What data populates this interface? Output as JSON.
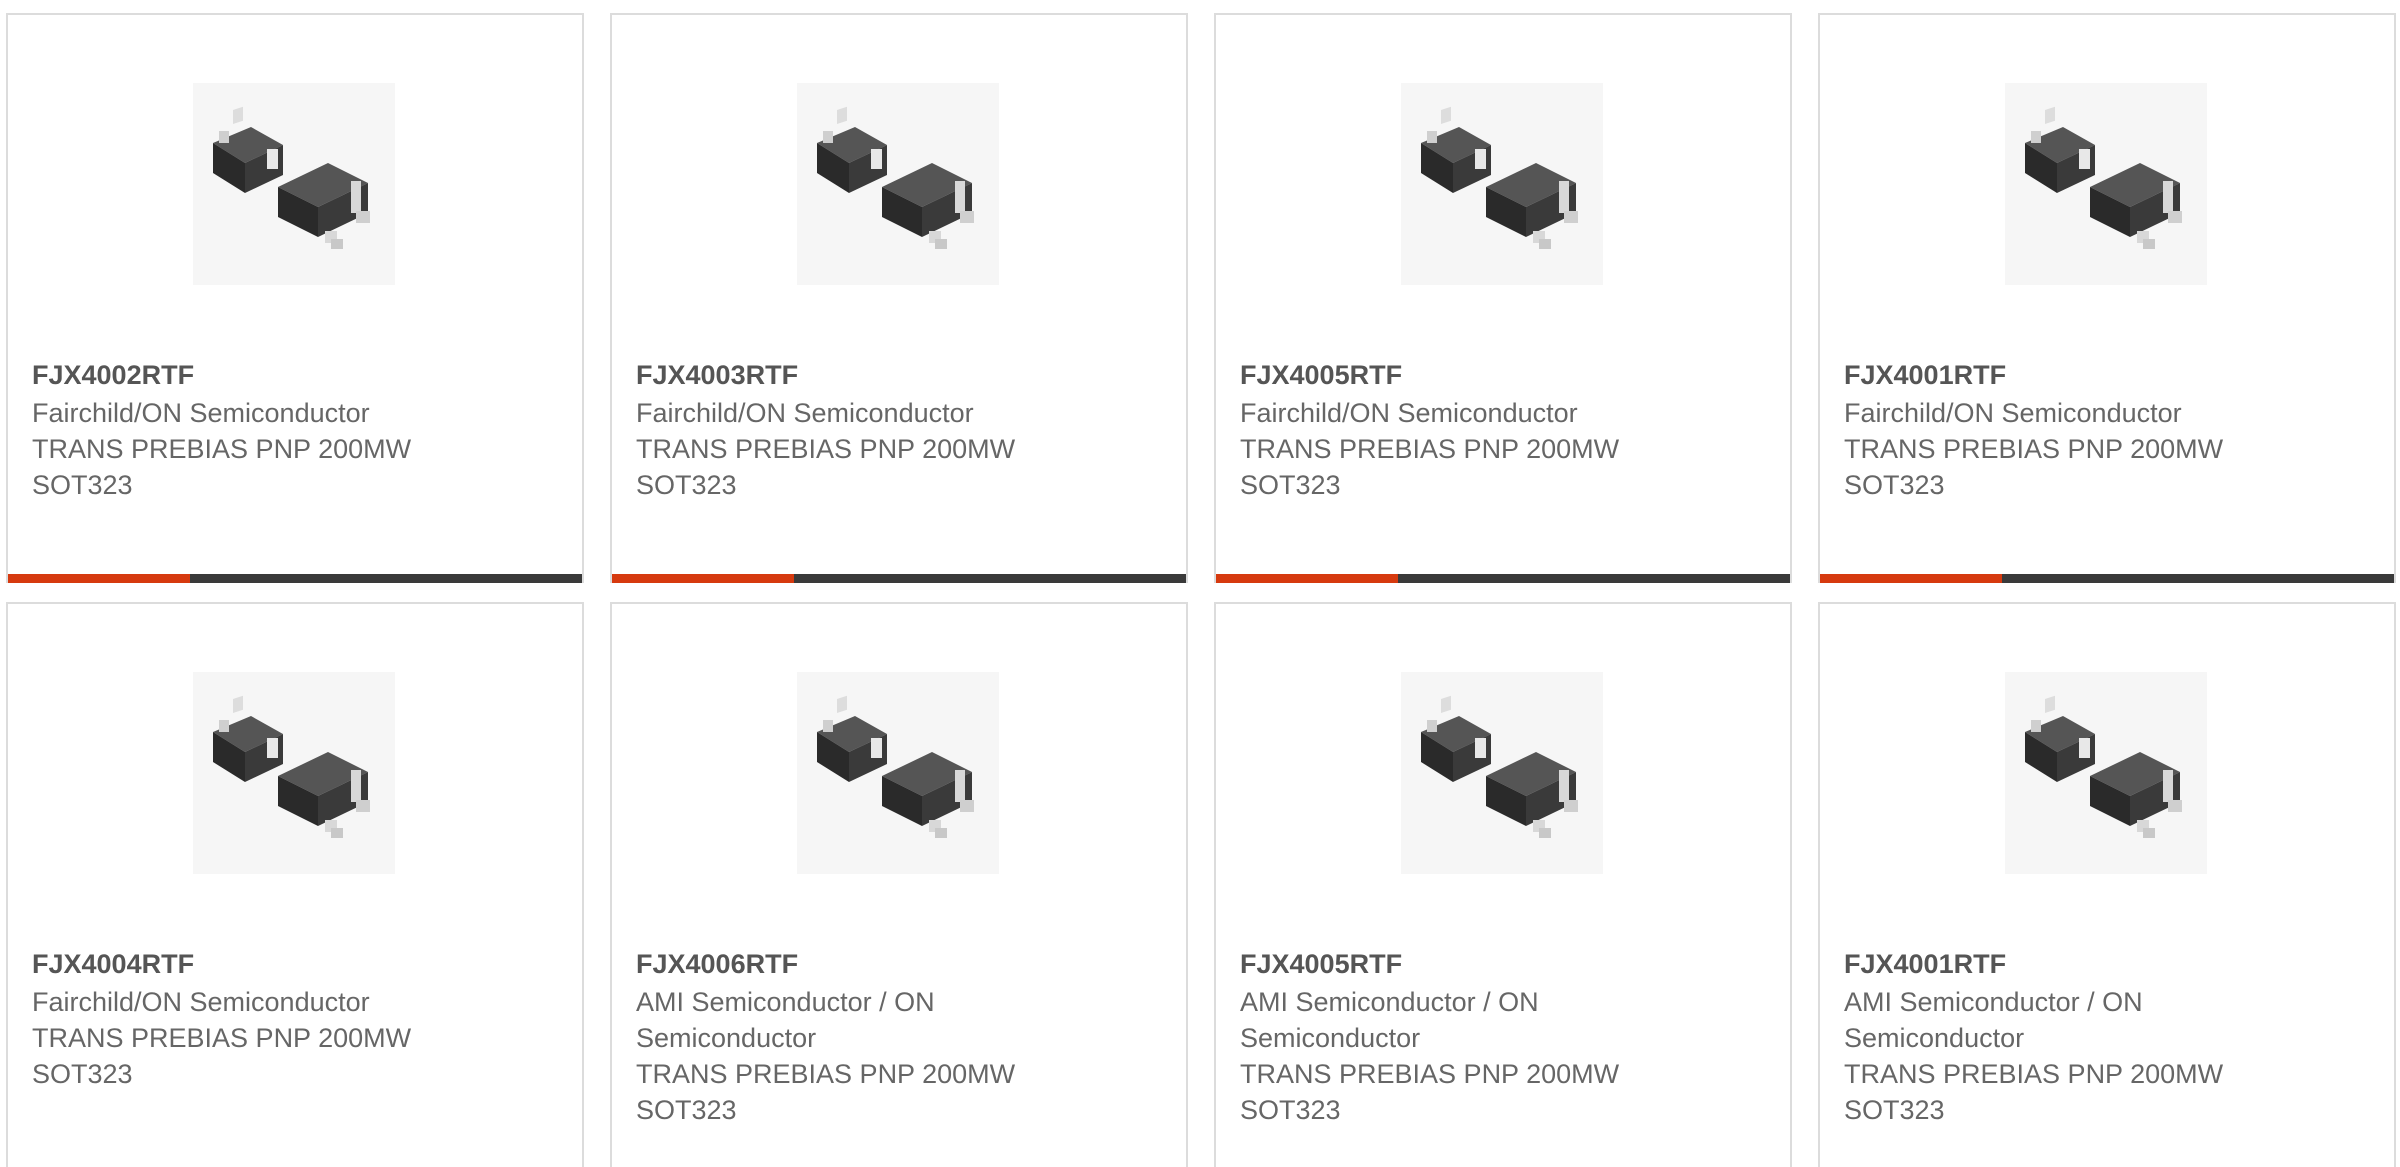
{
  "products": [
    {
      "part": "FJX4002RTF",
      "manufacturer": "Fairchild/ON Semiconductor",
      "description": "TRANS PREBIAS PNP 200MW SOT323",
      "image_icon": "sot323-package-image"
    },
    {
      "part": "FJX4003RTF",
      "manufacturer": "Fairchild/ON Semiconductor",
      "description": "TRANS PREBIAS PNP 200MW SOT323",
      "image_icon": "sot323-package-image"
    },
    {
      "part": "FJX4005RTF",
      "manufacturer": "Fairchild/ON Semiconductor",
      "description": "TRANS PREBIAS PNP 200MW SOT323",
      "image_icon": "sot323-package-image"
    },
    {
      "part": "FJX4001RTF",
      "manufacturer": "Fairchild/ON Semiconductor",
      "description": "TRANS PREBIAS PNP 200MW SOT323",
      "image_icon": "sot323-package-image"
    },
    {
      "part": "FJX4004RTF",
      "manufacturer": "Fairchild/ON Semiconductor",
      "description": "TRANS PREBIAS PNP 200MW SOT323",
      "image_icon": "sot323-package-image"
    },
    {
      "part": "FJX4006RTF",
      "manufacturer": "AMI Semiconductor / ON Semiconductor",
      "description": "TRANS PREBIAS PNP 200MW SOT323",
      "image_icon": "sot323-package-image"
    },
    {
      "part": "FJX4005RTF",
      "manufacturer": "AMI Semiconductor / ON Semiconductor",
      "description": "TRANS PREBIAS PNP 200MW SOT323",
      "image_icon": "sot323-package-image"
    },
    {
      "part": "FJX4001RTF",
      "manufacturer": "AMI Semiconductor / ON Semiconductor",
      "description": "TRANS PREBIAS PNP 200MW SOT323",
      "image_icon": "sot323-package-image"
    }
  ],
  "colors": {
    "accent": "#d63a0f",
    "bar": "#3a3a3a",
    "border": "#dcdcdc",
    "text": "#666666"
  }
}
